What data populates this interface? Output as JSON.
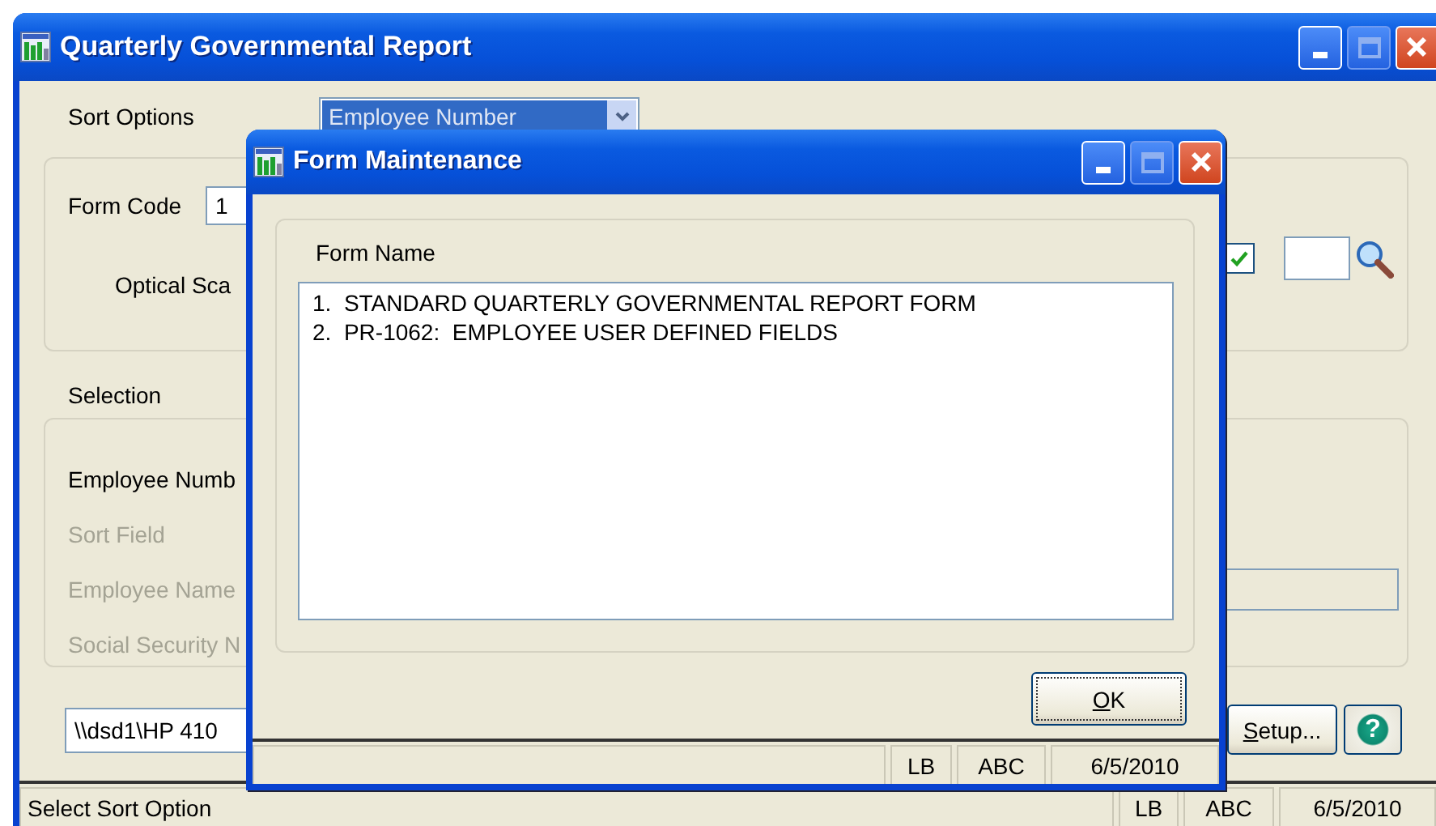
{
  "main_window": {
    "title": "Quarterly Governmental Report",
    "sort_options": {
      "label": "Sort Options",
      "value": "Employee Number"
    },
    "form_code": {
      "label": "Form Code",
      "value": "1"
    },
    "optical_scan": {
      "label": "Optical Sca"
    },
    "checkbox": {
      "checked": true
    },
    "selection": {
      "label": "Selection",
      "rows": [
        {
          "label": "Employee Numb",
          "disabled": false,
          "kind": "label"
        },
        {
          "label": "Sort Field",
          "disabled": true,
          "kind": "label"
        },
        {
          "label": "Employee Name",
          "disabled": true,
          "kind": "field"
        },
        {
          "label": "Social Security N",
          "disabled": true,
          "kind": "label"
        }
      ]
    },
    "printer": "\\\\dsd1\\HP 410",
    "setup_button": "Setup...",
    "help_button": "?",
    "status_bar": {
      "message": "Select Sort Option",
      "panels": [
        "LB",
        "ABC",
        "6/5/2010"
      ]
    }
  },
  "dialog": {
    "title": "Form Maintenance",
    "group_label": "Form Name",
    "items": [
      {
        "text": "1.  STANDARD QUARTERLY GOVERNMENTAL REPORT FORM",
        "selected": false
      },
      {
        "text": "2.  PR-1062:  EMPLOYEE USER DEFINED FIELDS",
        "selected": false
      }
    ],
    "ok_button": {
      "label": "OK",
      "focused": true
    },
    "status_bar": {
      "panels": [
        "LB",
        "ABC",
        "6/5/2010"
      ]
    }
  }
}
